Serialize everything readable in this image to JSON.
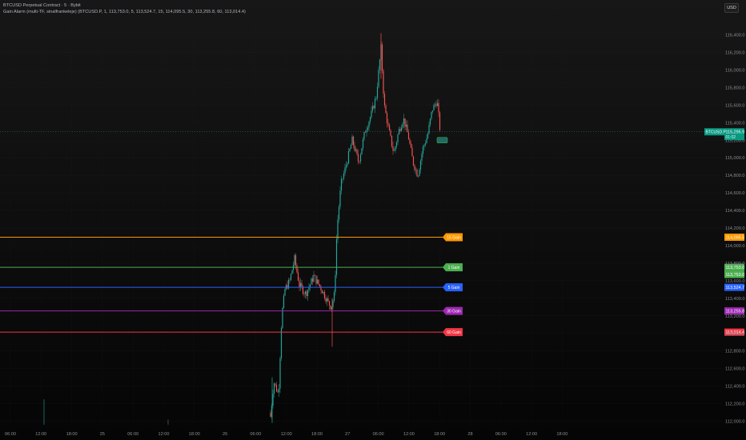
{
  "header": {
    "title": "BTCUSD Perpetual Contract · 5 · Bybit",
    "indicator": "Gain Alarm (multi-TF, sinalfrankeleje) (BTCUSD.P, 1, 113,753.0, 5, 113,524.7, 15, 114,095.5, 30, 113,255.8, 60, 113,014.4)"
  },
  "currency_button": "USD",
  "colors": {
    "candle_up": "#26a69a",
    "candle_down": "#ef5350",
    "grid": "#242424",
    "price_line": "#26a69a",
    "line_1": "#4caf50",
    "line_5": "#2962ff",
    "line_15": "#ff9800",
    "line_30": "#9c27b0",
    "line_60": "#f23645"
  },
  "price_axis": {
    "min": 111950,
    "max": 116560,
    "ticks": [
      "116,400.0",
      "116,200.0",
      "116,000.0",
      "115,800.0",
      "115,600.0",
      "115,400.0",
      "115,200.0",
      "115,000.0",
      "114,800.0",
      "114,600.0",
      "114,400.0",
      "114,200.0",
      "114,000.0",
      "113,800.0",
      "113,600.0",
      "113,400.0",
      "113,200.0",
      "113,000.0",
      "112,800.0",
      "112,600.0",
      "112,400.0",
      "112,200.0",
      "112,000.0"
    ]
  },
  "time_axis": {
    "ticks": [
      "06:00",
      "12:00",
      "18:00",
      "25",
      "06:00",
      "12:00",
      "18:00",
      "26",
      "06:00",
      "12:00",
      "18:00",
      "27",
      "06:00",
      "12:00",
      "18:00",
      "28",
      "06:00",
      "12:00",
      "18:00"
    ]
  },
  "current_price": {
    "symbol": "BTCUSD.P",
    "price": "115,295.9",
    "countdown": "01:02",
    "value": 115295.9
  },
  "gain_lines": [
    {
      "label": "15 Gain",
      "price_label": "114,095.5",
      "value": 114095.5,
      "color": "#ff9800"
    },
    {
      "label": "1 Gain",
      "price_label": "113,753.0",
      "value": 113753.0,
      "color": "#4caf50"
    },
    {
      "label": "5 Gain",
      "price_label": "113,524.7",
      "value": 113524.7,
      "color": "#2962ff"
    },
    {
      "label": "30 Gain",
      "price_label": "113,255.8",
      "value": 113255.8,
      "color": "#9c27b0"
    },
    {
      "label": "60 Gain",
      "price_label": "113,014.4",
      "value": 113014.4,
      "color": "#f23645"
    }
  ],
  "extra_price_tag": "113,753.0"
}
